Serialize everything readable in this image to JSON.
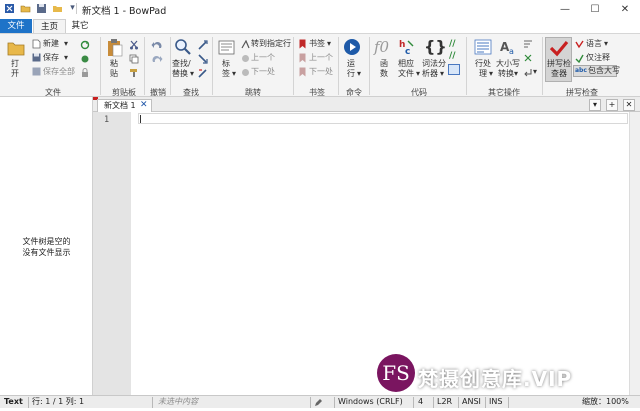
{
  "window": {
    "title": "新文档 1 - BowPad",
    "controls": {
      "minimize": "—",
      "maximize": "☐",
      "close": "✕"
    }
  },
  "ribbon": {
    "tabs": [
      {
        "label": "文件",
        "state": "file-menu"
      },
      {
        "label": "主页",
        "state": "selected"
      },
      {
        "label": "其它",
        "state": "normal"
      }
    ],
    "groups": {
      "file": {
        "label": "文件",
        "open_top": "打",
        "open_bottom": "开",
        "new": "新建",
        "save": "保存",
        "save_all": "保存全部"
      },
      "clipboard": {
        "label": "剪贴板",
        "paste_top": "粘",
        "paste_bottom": "贴"
      },
      "undo": {
        "label": "撤销"
      },
      "find": {
        "label": "查找",
        "find_replace_top": "查找/",
        "find_replace_bottom": "替换"
      },
      "goto": {
        "label": "跳转",
        "tags_top": "标",
        "tags_bottom": "签",
        "goto_line": "转到指定行",
        "prev": "上一个",
        "next": "下一处"
      },
      "bookmarks": {
        "label": "书签",
        "bookmark": "书签",
        "prev": "上一个",
        "next": "下一处"
      },
      "command": {
        "label": "命令",
        "run_top": "运",
        "run_bottom": "行"
      },
      "code": {
        "label": "代码",
        "function_top": "函",
        "function_bottom": "数",
        "related_top": "相应",
        "related_bottom": "文件",
        "lexer_top": "词法分",
        "lexer_bottom": "析器"
      },
      "other_ops": {
        "label": "其它操作",
        "line_ops_top": "行处",
        "line_ops_bottom": "理",
        "case_top": "大小写",
        "case_bottom": "转换"
      },
      "spell": {
        "label": "拼写检查",
        "spell_check_top": "拼写检",
        "spell_check_bottom": "查器",
        "language": "语言",
        "comments_only": "仅注释",
        "include_upper": "包含大写"
      }
    }
  },
  "left_panel": {
    "message_line1": "文件树是空的",
    "message_line2": "没有文件显示"
  },
  "editor": {
    "tab_label": "新文档 1",
    "tab_close": "✕",
    "line_numbers": [
      "1"
    ],
    "tab_controls": {
      "dropdown": "▾",
      "add": "+",
      "close": "✕"
    }
  },
  "statusbar": {
    "mode": "Text",
    "position": "行: 1 / 1   列: 1",
    "hint": "未选中内容",
    "line_ending": "Windows (CRLF)",
    "tab_width": "4",
    "direction": "L2R",
    "encoding": "ANSI",
    "insert_mode": "INS",
    "zoom": "缩放：100%"
  },
  "watermark": {
    "badge": "FS",
    "text": "梵摄创意库.VIP"
  },
  "colors": {
    "file_tab": "#1e73c8",
    "ribbon_bg": "#f4f4f4",
    "gutter": "#e4e4e4",
    "accent_red": "#c82020",
    "watermark_badge": "#7a1560"
  }
}
